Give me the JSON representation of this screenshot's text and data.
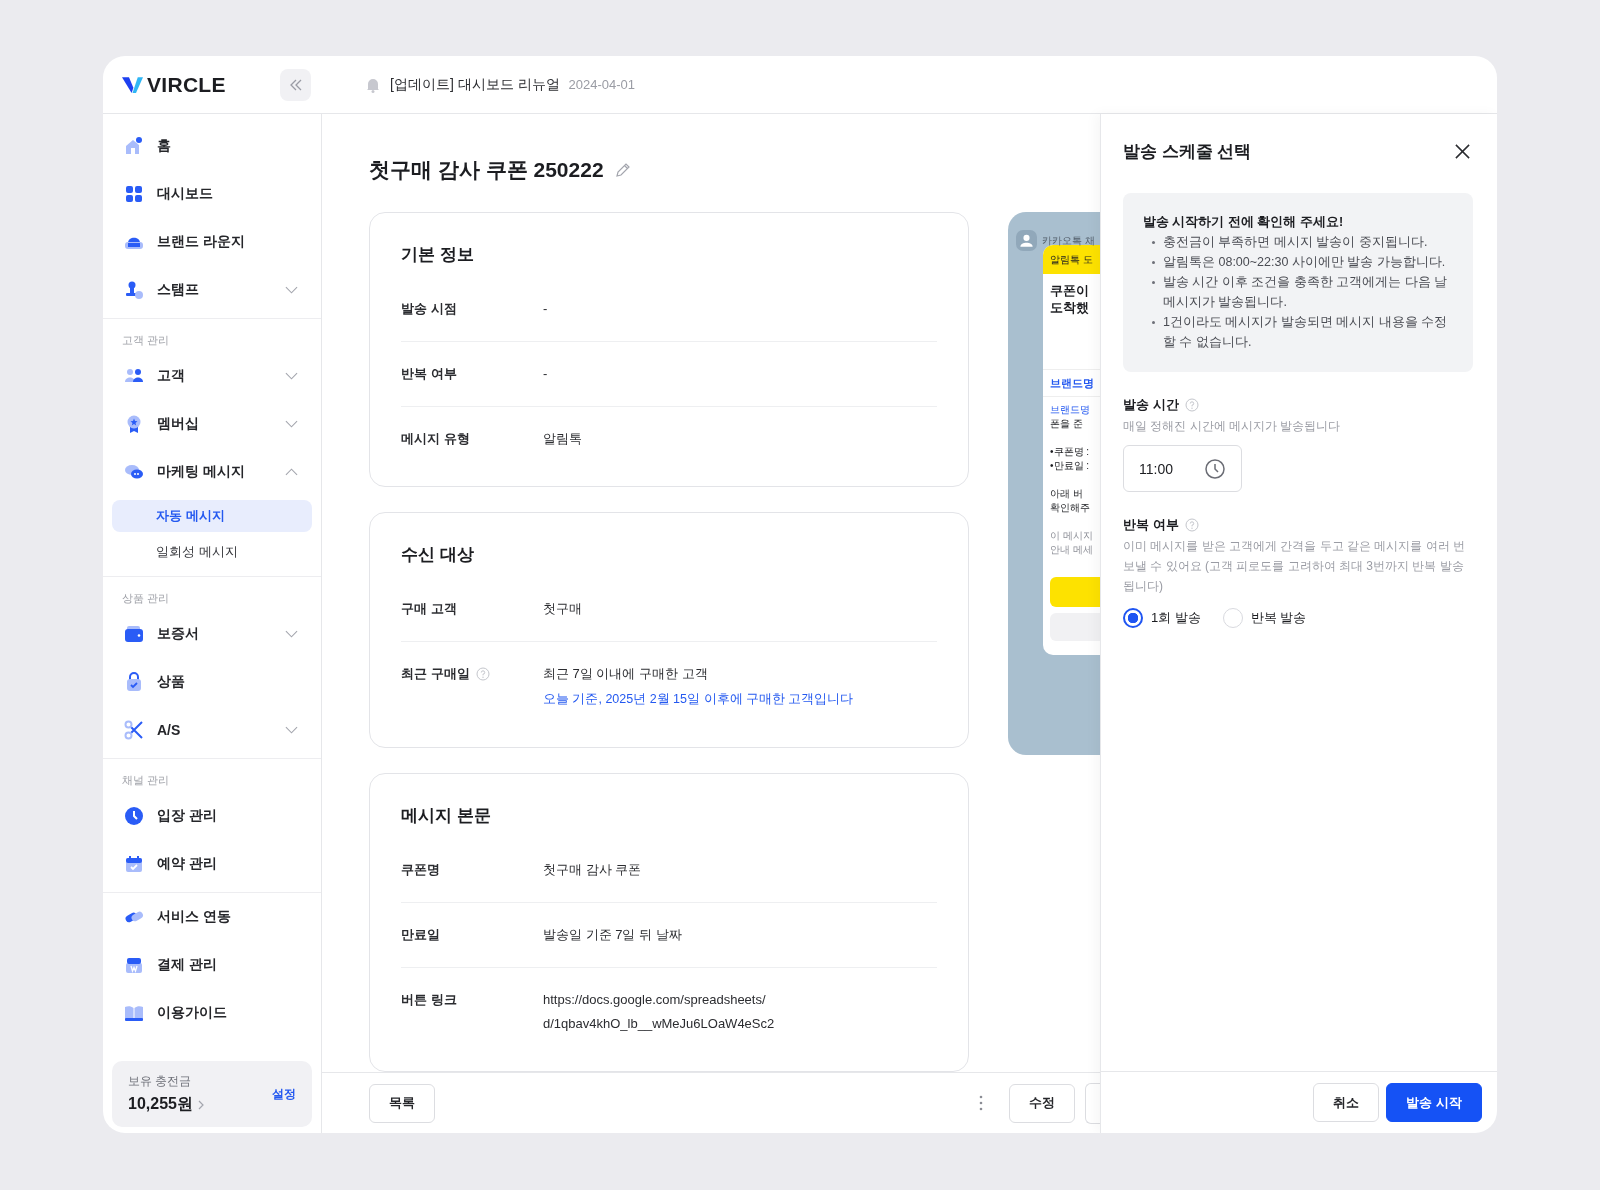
{
  "brand": {
    "name": "VIRCLE"
  },
  "notice": {
    "text": "[업데이트] 대시보드 리뉴얼",
    "date": "2024-04-01"
  },
  "sidebar": {
    "groups": [
      {
        "items": [
          {
            "label": "홈"
          },
          {
            "label": "대시보드"
          },
          {
            "label": "브랜드 라운지"
          },
          {
            "label": "스탬프",
            "expanded": false
          }
        ]
      },
      {
        "title": "고객 관리",
        "items": [
          {
            "label": "고객",
            "expanded": false
          },
          {
            "label": "멤버십",
            "expanded": false
          },
          {
            "label": "마케팅 메시지",
            "expanded": true,
            "children": [
              {
                "label": "자동 메시지",
                "selected": true
              },
              {
                "label": "일회성 메시지",
                "selected": false
              }
            ]
          }
        ]
      },
      {
        "title": "상품 관리",
        "items": [
          {
            "label": "보증서",
            "expanded": false
          },
          {
            "label": "상품"
          },
          {
            "label": "A/S",
            "expanded": false
          }
        ]
      },
      {
        "title": "채널 관리",
        "items": [
          {
            "label": "입장 관리"
          },
          {
            "label": "예약 관리"
          }
        ]
      },
      {
        "items": [
          {
            "label": "서비스 연동"
          },
          {
            "label": "결제 관리"
          },
          {
            "label": "이용가이드"
          }
        ]
      }
    ],
    "balance": {
      "label": "보유 충전금",
      "amount": "10,255원",
      "action": "설정"
    }
  },
  "main": {
    "title": "첫구매 감사 쿠폰 250222",
    "cards": [
      {
        "title": "기본 정보",
        "rows": [
          {
            "label": "발송 시점",
            "value": "-"
          },
          {
            "label": "반복 여부",
            "value": "-"
          },
          {
            "label": "메시지 유형",
            "value": "알림톡"
          }
        ]
      },
      {
        "title": "수신 대상",
        "rows": [
          {
            "label": "구매 고객",
            "value": "첫구매"
          },
          {
            "label": "최근 구매일",
            "help": true,
            "value": "최근 7일 이내에 구매한 고객",
            "note": "오늘 기준, 2025년 2월 15일 이후에 구매한 고객입니다"
          }
        ]
      },
      {
        "title": "메시지 본문",
        "rows": [
          {
            "label": "쿠폰명",
            "value": "첫구매 감사 쿠폰"
          },
          {
            "label": "만료일",
            "value": "발송일 기준 7일 뒤 날짜"
          },
          {
            "label": "버튼 링크",
            "value": "https://docs.google.com/spreadsheets/",
            "value2": "d/1qbav4khO_lb__wMeJu6LOaW4eSc2"
          }
        ]
      }
    ],
    "preview": {
      "channel": "카카오톡 채",
      "badge": "알림톡 도",
      "headline": [
        "쿠폰이",
        "도착했"
      ],
      "brand": "브랜드명",
      "body": [
        {
          "text": "브랜드명",
          "kind": "link"
        },
        {
          "text": "폰을 준",
          "kind": "text"
        },
        {
          "text": "•쿠폰명 :",
          "kind": "gap"
        },
        {
          "text": "•만료일 :",
          "kind": "text"
        },
        {
          "text": "아래 버",
          "kind": "gap"
        },
        {
          "text": "확인해주",
          "kind": "text"
        },
        {
          "text": "이 메시지",
          "kind": "note"
        },
        {
          "text": "안내 메세",
          "kind": "note"
        }
      ]
    },
    "footer": {
      "list_button": "목록",
      "edit_button": "수정"
    }
  },
  "drawer": {
    "title": "발송 스케줄 선택",
    "info": {
      "title": "발송 시작하기 전에 확인해 주세요!",
      "items": [
        "충전금이 부족하면 메시지 발송이 중지됩니다.",
        "알림톡은 08:00~22:30 사이에만 발송 가능합니다.",
        "발송 시간 이후 조건을 충족한 고객에게는 다음 날 메시지가 발송됩니다.",
        "1건이라도 메시지가 발송되면 메시지 내용을 수정할 수 없습니다."
      ]
    },
    "time": {
      "label": "발송 시간",
      "description": "매일 정해진 시간에 메시지가 발송됩니다",
      "value": "11:00"
    },
    "repeat": {
      "label": "반복 여부",
      "description": "이미 메시지를 받은 고객에게 간격을 두고 같은 메시지를 여러 번 보낼 수 있어요 (고객 피로도를 고려하여 최대 3번까지 반복 발송됩니다)",
      "options": [
        {
          "label": "1회 발송",
          "selected": true
        },
        {
          "label": "반복 발송",
          "selected": false
        }
      ]
    },
    "buttons": {
      "cancel": "취소",
      "start": "발송 시작"
    }
  }
}
